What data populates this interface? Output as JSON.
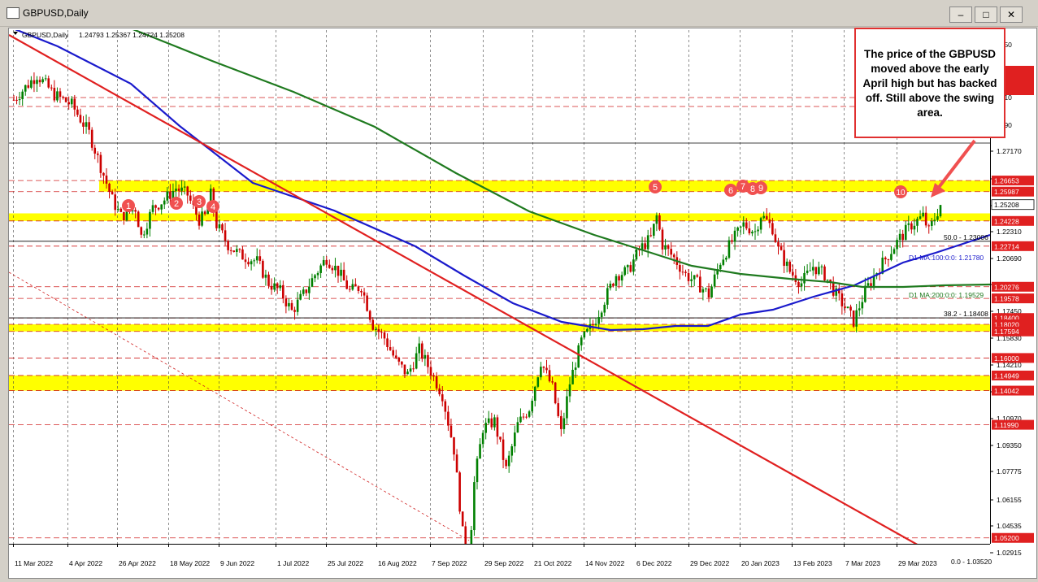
{
  "window": {
    "title": "GBPUSD,Daily",
    "buttons": [
      "minimize",
      "maximize",
      "close"
    ]
  },
  "chart_data": {
    "type": "candlestick",
    "symbol_label": "GBPUSD,Daily",
    "ohlc_label": "1.24793 1.25367 1.24724 1.25208",
    "colors": {
      "bull": "#008000",
      "bear": "#cc0000",
      "ma100": "#1a1acc",
      "ma200": "#1f7a1f",
      "trend": "#e02020",
      "zone": "#ffff00",
      "price_tag": "#e02020"
    },
    "x_ticks": [
      "11 Mar 2022",
      "4 Apr 2022",
      "26 Apr 2022",
      "18 May 2022",
      "9 Jun 2022",
      "1 Jul 2022",
      "25 Jul 2022",
      "16 Aug 2022",
      "7 Sep 2022",
      "29 Sep 2022",
      "21 Oct 2022",
      "14 Nov 2022",
      "6 Dec 2022",
      "29 Dec 2022",
      "20 Jan 2023",
      "13 Feb 2023",
      "7 Mar 2023",
      "29 Mar 2023"
    ],
    "y_ticks_visible": [
      "3650",
      "2089",
      "1588",
      "1330",
      "0410",
      "8790",
      "1.27170",
      "1.25550",
      "1.23930",
      "1.22310",
      "1.20690",
      "1.19070",
      "1.17450",
      "1.15830",
      "1.14210",
      "1.12590",
      "1.10970",
      "1.09350",
      "1.07775",
      "1.06155",
      "1.04535",
      "1.02915"
    ],
    "price_tags": [
      {
        "label": "1.26653",
        "value": 1.26653
      },
      {
        "label": "1.25987",
        "value": 1.25987
      },
      {
        "label": "1.25208",
        "value": 1.25208
      },
      {
        "label": "1.24228",
        "value": 1.24228
      },
      {
        "label": "1.22714",
        "value": 1.22714
      },
      {
        "label": "1.20276",
        "value": 1.20276
      },
      {
        "label": "1.19578",
        "value": 1.19578
      },
      {
        "label": "1.18400",
        "value": 1.184
      },
      {
        "label": "1.18020",
        "value": 1.1802
      },
      {
        "label": "1.17594",
        "value": 1.17594
      },
      {
        "label": "1.16000",
        "value": 1.16
      },
      {
        "label": "1.14949",
        "value": 1.14949
      },
      {
        "label": "1.14042",
        "value": 1.14042
      },
      {
        "label": "1.11990",
        "value": 1.1199
      },
      {
        "label": "1.05200",
        "value": 1.052
      }
    ],
    "zones": [
      {
        "low": 1.25987,
        "high": 1.26653
      },
      {
        "low": 1.24228,
        "high": 1.24682
      },
      {
        "low": 1.17594,
        "high": 1.1802
      },
      {
        "low": 1.14042,
        "high": 1.14949
      }
    ],
    "indicator_labels": [
      {
        "text": "50.0 - 1.23006",
        "value": 1.23006
      },
      {
        "text": "D1 MA:100:0:0: 1.21780",
        "value": 1.2178
      },
      {
        "text": "D1 MA:200:0:0: 1.19529",
        "value": 1.19529
      },
      {
        "text": "38.2 - 1.18408",
        "value": 1.18408
      },
      {
        "text": "0.0 - 1.03520",
        "value": 1.0352
      }
    ],
    "swing_markers": [
      "1",
      "2",
      "3",
      "4",
      "5",
      "6",
      "7",
      "8",
      "9",
      "10"
    ],
    "annotation": "The price of the GBPUSD moved above the early April high but has backed off. Still above the swing area.",
    "ylim": [
      1.025,
      1.37
    ]
  }
}
